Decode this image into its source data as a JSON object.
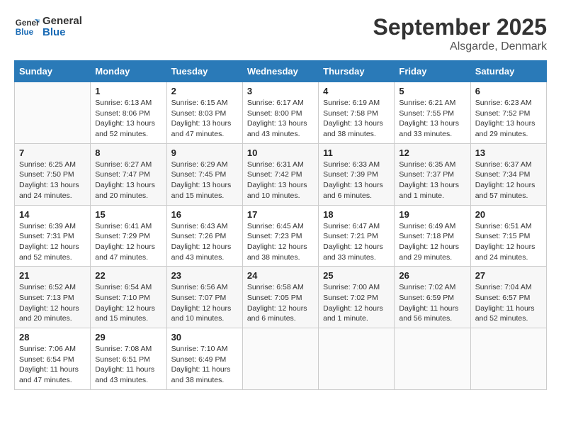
{
  "header": {
    "logo_line1": "General",
    "logo_line2": "Blue",
    "month": "September 2025",
    "location": "Alsgarde, Denmark"
  },
  "weekdays": [
    "Sunday",
    "Monday",
    "Tuesday",
    "Wednesday",
    "Thursday",
    "Friday",
    "Saturday"
  ],
  "weeks": [
    [
      {
        "day": "",
        "empty": true
      },
      {
        "day": "1",
        "sunrise": "6:13 AM",
        "sunset": "8:06 PM",
        "daylight": "13 hours and 52 minutes."
      },
      {
        "day": "2",
        "sunrise": "6:15 AM",
        "sunset": "8:03 PM",
        "daylight": "13 hours and 47 minutes."
      },
      {
        "day": "3",
        "sunrise": "6:17 AM",
        "sunset": "8:00 PM",
        "daylight": "13 hours and 43 minutes."
      },
      {
        "day": "4",
        "sunrise": "6:19 AM",
        "sunset": "7:58 PM",
        "daylight": "13 hours and 38 minutes."
      },
      {
        "day": "5",
        "sunrise": "6:21 AM",
        "sunset": "7:55 PM",
        "daylight": "13 hours and 33 minutes."
      },
      {
        "day": "6",
        "sunrise": "6:23 AM",
        "sunset": "7:52 PM",
        "daylight": "13 hours and 29 minutes."
      }
    ],
    [
      {
        "day": "7",
        "sunrise": "6:25 AM",
        "sunset": "7:50 PM",
        "daylight": "13 hours and 24 minutes."
      },
      {
        "day": "8",
        "sunrise": "6:27 AM",
        "sunset": "7:47 PM",
        "daylight": "13 hours and 20 minutes."
      },
      {
        "day": "9",
        "sunrise": "6:29 AM",
        "sunset": "7:45 PM",
        "daylight": "13 hours and 15 minutes."
      },
      {
        "day": "10",
        "sunrise": "6:31 AM",
        "sunset": "7:42 PM",
        "daylight": "13 hours and 10 minutes."
      },
      {
        "day": "11",
        "sunrise": "6:33 AM",
        "sunset": "7:39 PM",
        "daylight": "13 hours and 6 minutes."
      },
      {
        "day": "12",
        "sunrise": "6:35 AM",
        "sunset": "7:37 PM",
        "daylight": "13 hours and 1 minute."
      },
      {
        "day": "13",
        "sunrise": "6:37 AM",
        "sunset": "7:34 PM",
        "daylight": "12 hours and 57 minutes."
      }
    ],
    [
      {
        "day": "14",
        "sunrise": "6:39 AM",
        "sunset": "7:31 PM",
        "daylight": "12 hours and 52 minutes."
      },
      {
        "day": "15",
        "sunrise": "6:41 AM",
        "sunset": "7:29 PM",
        "daylight": "12 hours and 47 minutes."
      },
      {
        "day": "16",
        "sunrise": "6:43 AM",
        "sunset": "7:26 PM",
        "daylight": "12 hours and 43 minutes."
      },
      {
        "day": "17",
        "sunrise": "6:45 AM",
        "sunset": "7:23 PM",
        "daylight": "12 hours and 38 minutes."
      },
      {
        "day": "18",
        "sunrise": "6:47 AM",
        "sunset": "7:21 PM",
        "daylight": "12 hours and 33 minutes."
      },
      {
        "day": "19",
        "sunrise": "6:49 AM",
        "sunset": "7:18 PM",
        "daylight": "12 hours and 29 minutes."
      },
      {
        "day": "20",
        "sunrise": "6:51 AM",
        "sunset": "7:15 PM",
        "daylight": "12 hours and 24 minutes."
      }
    ],
    [
      {
        "day": "21",
        "sunrise": "6:52 AM",
        "sunset": "7:13 PM",
        "daylight": "12 hours and 20 minutes."
      },
      {
        "day": "22",
        "sunrise": "6:54 AM",
        "sunset": "7:10 PM",
        "daylight": "12 hours and 15 minutes."
      },
      {
        "day": "23",
        "sunrise": "6:56 AM",
        "sunset": "7:07 PM",
        "daylight": "12 hours and 10 minutes."
      },
      {
        "day": "24",
        "sunrise": "6:58 AM",
        "sunset": "7:05 PM",
        "daylight": "12 hours and 6 minutes."
      },
      {
        "day": "25",
        "sunrise": "7:00 AM",
        "sunset": "7:02 PM",
        "daylight": "12 hours and 1 minute."
      },
      {
        "day": "26",
        "sunrise": "7:02 AM",
        "sunset": "6:59 PM",
        "daylight": "11 hours and 56 minutes."
      },
      {
        "day": "27",
        "sunrise": "7:04 AM",
        "sunset": "6:57 PM",
        "daylight": "11 hours and 52 minutes."
      }
    ],
    [
      {
        "day": "28",
        "sunrise": "7:06 AM",
        "sunset": "6:54 PM",
        "daylight": "11 hours and 47 minutes."
      },
      {
        "day": "29",
        "sunrise": "7:08 AM",
        "sunset": "6:51 PM",
        "daylight": "11 hours and 43 minutes."
      },
      {
        "day": "30",
        "sunrise": "7:10 AM",
        "sunset": "6:49 PM",
        "daylight": "11 hours and 38 minutes."
      },
      {
        "day": "",
        "empty": true
      },
      {
        "day": "",
        "empty": true
      },
      {
        "day": "",
        "empty": true
      },
      {
        "day": "",
        "empty": true
      }
    ]
  ],
  "labels": {
    "sunrise_prefix": "Sunrise: ",
    "sunset_prefix": "Sunset: ",
    "daylight_prefix": "Daylight: "
  }
}
